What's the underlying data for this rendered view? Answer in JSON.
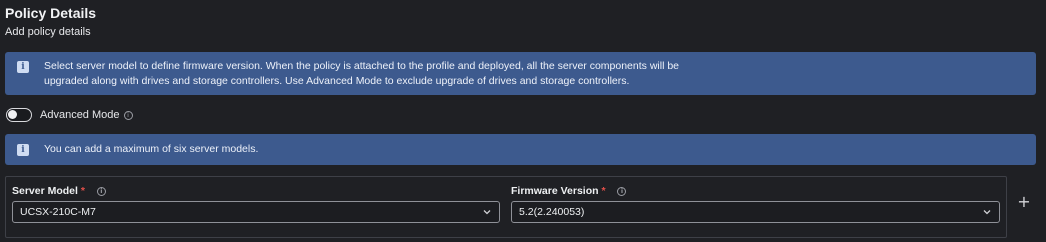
{
  "header": {
    "title": "Policy Details",
    "subtitle": "Add policy details"
  },
  "info_banner": {
    "icon": "info-icon",
    "line1": "Select server model to define firmware version. When the policy is attached to the profile and deployed, all the server components will be",
    "line2": "upgraded along with drives and storage controllers. Use Advanced Mode to exclude upgrade of drives and storage controllers."
  },
  "advanced_mode": {
    "label": "Advanced Mode",
    "enabled": false
  },
  "limit_banner": {
    "icon": "info-icon",
    "text": "You can add a maximum of six server models."
  },
  "server_model": {
    "label": "Server Model",
    "required_mark": "*",
    "value": "UCSX-210C-M7"
  },
  "firmware_version": {
    "label": "Firmware Version",
    "required_mark": "*",
    "value": "5.2(2.240053)"
  },
  "add_button": {
    "symbol": "+"
  },
  "colors": {
    "background": "#1f2024",
    "banner": "#3d5a8e",
    "required": "#e2504a",
    "text": "#e8e9ec"
  }
}
